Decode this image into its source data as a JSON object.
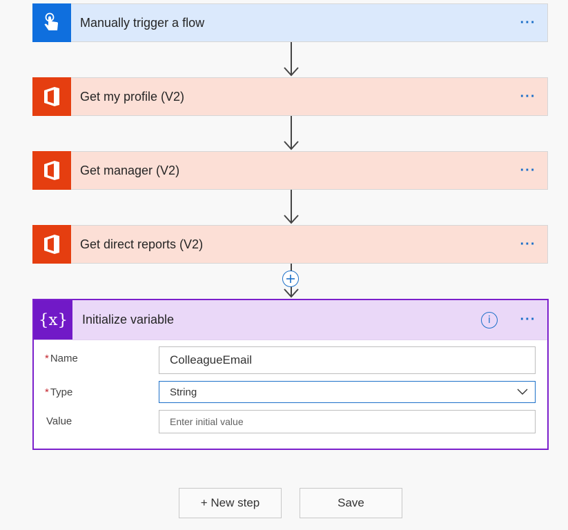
{
  "steps": [
    {
      "title": "Manually trigger a flow",
      "more": "···",
      "icon": "touch-icon"
    },
    {
      "title": "Get my profile (V2)",
      "more": "···",
      "icon": "office-icon"
    },
    {
      "title": "Get manager (V2)",
      "more": "···",
      "icon": "office-icon"
    },
    {
      "title": "Get direct reports (V2)",
      "more": "···",
      "icon": "office-icon"
    }
  ],
  "variable_card": {
    "icon_text": "{x}",
    "title": "Initialize variable",
    "info": "i",
    "more": "···",
    "fields": {
      "name": {
        "label": "Name",
        "required_mark": "*",
        "value": "ColleagueEmail"
      },
      "type": {
        "label": "Type",
        "required_mark": "*",
        "value": "String"
      },
      "value": {
        "label": "Value",
        "placeholder": "Enter initial value"
      }
    }
  },
  "buttons": {
    "new_step": "+ New step",
    "save": "Save"
  },
  "colors": {
    "trigger_bg": "#dbe9fc",
    "office_bg": "#fcdfd6",
    "variable_accent": "#7119c7",
    "link_blue": "#1b6fc8"
  }
}
